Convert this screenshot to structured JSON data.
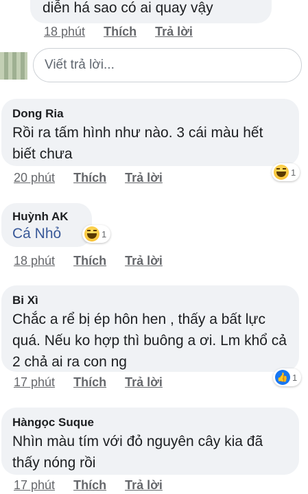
{
  "top_comment": {
    "text": "diễn há sao có ai quay vậy",
    "time": "18 phút",
    "like": "Thích",
    "reply": "Trả lời"
  },
  "reply_box": {
    "placeholder": "Viết trả lời..."
  },
  "comments": [
    {
      "author": "Dong Ria",
      "text": "Rồi ra tấm hình như nào. 3 cái màu hết biết chưa",
      "time": "20 phút",
      "like": "Thích",
      "reply": "Trả lời",
      "reaction": {
        "icon": "haha-icon",
        "count": "1"
      }
    },
    {
      "author": "Huỳnh AK",
      "text": "Cá Nhỏ",
      "time": "18 phút",
      "like": "Thích",
      "reply": "Trả lời",
      "reaction": {
        "icon": "haha-icon",
        "count": "1"
      }
    },
    {
      "author": "Bi Xì",
      "text": "Chắc a rể bị ép hôn hen , thấy a bất lực quá. Nếu ko hợp thì buông a ơi. Lm khổ cả 2 chả ai ra con ng",
      "time": "17 phút",
      "like": "Thích",
      "reply": "Trả lời",
      "reaction": {
        "icon": "like-icon",
        "count": "1"
      }
    },
    {
      "author": "Hàngọc Suque",
      "text": "Nhìn màu tím với đỏ nguyên cây kia đã thấy nóng rồi",
      "time": "17 phút",
      "like": "Thích",
      "reply": "Trả lời"
    }
  ],
  "colors": {
    "bubble": "#f0f2f5",
    "meta": "#65676b",
    "mention": "#385898",
    "like_blue": "#1877f2"
  }
}
